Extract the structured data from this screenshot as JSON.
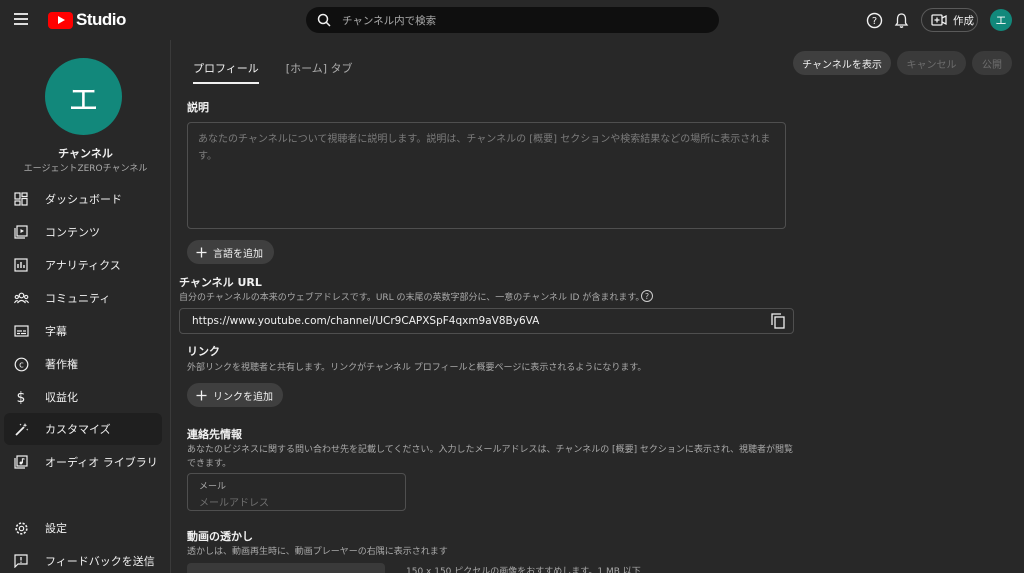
{
  "topbar": {
    "logo_text": "Studio",
    "search_placeholder": "チャンネル内で検索",
    "create_label": "作成",
    "avatar_letter": "エ"
  },
  "sidebar": {
    "avatar_letter": "エ",
    "channel_title": "チャンネル",
    "channel_name": "エージェントZEROチャンネル",
    "items": [
      {
        "label": "ダッシュボード",
        "icon": "dashboard-icon"
      },
      {
        "label": "コンテンツ",
        "icon": "content-icon"
      },
      {
        "label": "アナリティクス",
        "icon": "analytics-icon"
      },
      {
        "label": "コミュニティ",
        "icon": "community-icon"
      },
      {
        "label": "字幕",
        "icon": "subtitles-icon"
      },
      {
        "label": "著作権",
        "icon": "copyright-icon"
      },
      {
        "label": "収益化",
        "icon": "dollar-icon"
      },
      {
        "label": "カスタマイズ",
        "icon": "magic-wand-icon",
        "active": true
      },
      {
        "label": "オーディオ ライブラリ",
        "icon": "audio-library-icon"
      }
    ],
    "bottom_items": [
      {
        "label": "設定",
        "icon": "gear-icon"
      },
      {
        "label": "フィードバックを送信",
        "icon": "feedback-icon"
      }
    ]
  },
  "main": {
    "tabs": [
      {
        "label": "プロフィール",
        "active": true
      },
      {
        "label": "[ホーム] タブ",
        "active": false
      }
    ],
    "buttons": {
      "view_channel": "チャンネルを表示",
      "cancel": "キャンセル",
      "publish": "公開"
    },
    "description": {
      "label": "説明",
      "placeholder": "あなたのチャンネルについて視聴者に説明します。説明は、チャンネルの [概要] セクションや検索結果などの場所に表示されます。",
      "add_language": "言語を追加"
    },
    "channel_url": {
      "label": "チャンネル URL",
      "help": "自分のチャンネルの本来のウェブアドレスです。URL の末尾の英数字部分に、一意のチャンネル ID が含まれます。",
      "value": "https://www.youtube.com/channel/UCr9CAPXSpF4qxm9aV8By6VA"
    },
    "links": {
      "label": "リンク",
      "help": "外部リンクを視聴者と共有します。リンクがチャンネル プロフィールと概要ページに表示されるようになります。",
      "add_link": "リンクを追加"
    },
    "contact": {
      "label": "連絡先情報",
      "help_line1": "あなたのビジネスに関する問い合わせ先を記載してください。入力したメールアドレスは、チャンネルの [概要] セクションに表示され、視聴者が閲覧",
      "help_line2": "できます。",
      "email_label": "メール",
      "email_placeholder": "メールアドレス"
    },
    "watermark": {
      "label": "動画の透かし",
      "help": "透かしは、動画再生時に、動画プレーヤーの右隅に表示されます",
      "recommendation": "150 x 150 ピクセルの画像をおすすめします。1 MB 以下"
    }
  },
  "colors": {
    "background": "#282828",
    "accent_avatar": "#12887b",
    "youtube_red": "#ff0000"
  }
}
